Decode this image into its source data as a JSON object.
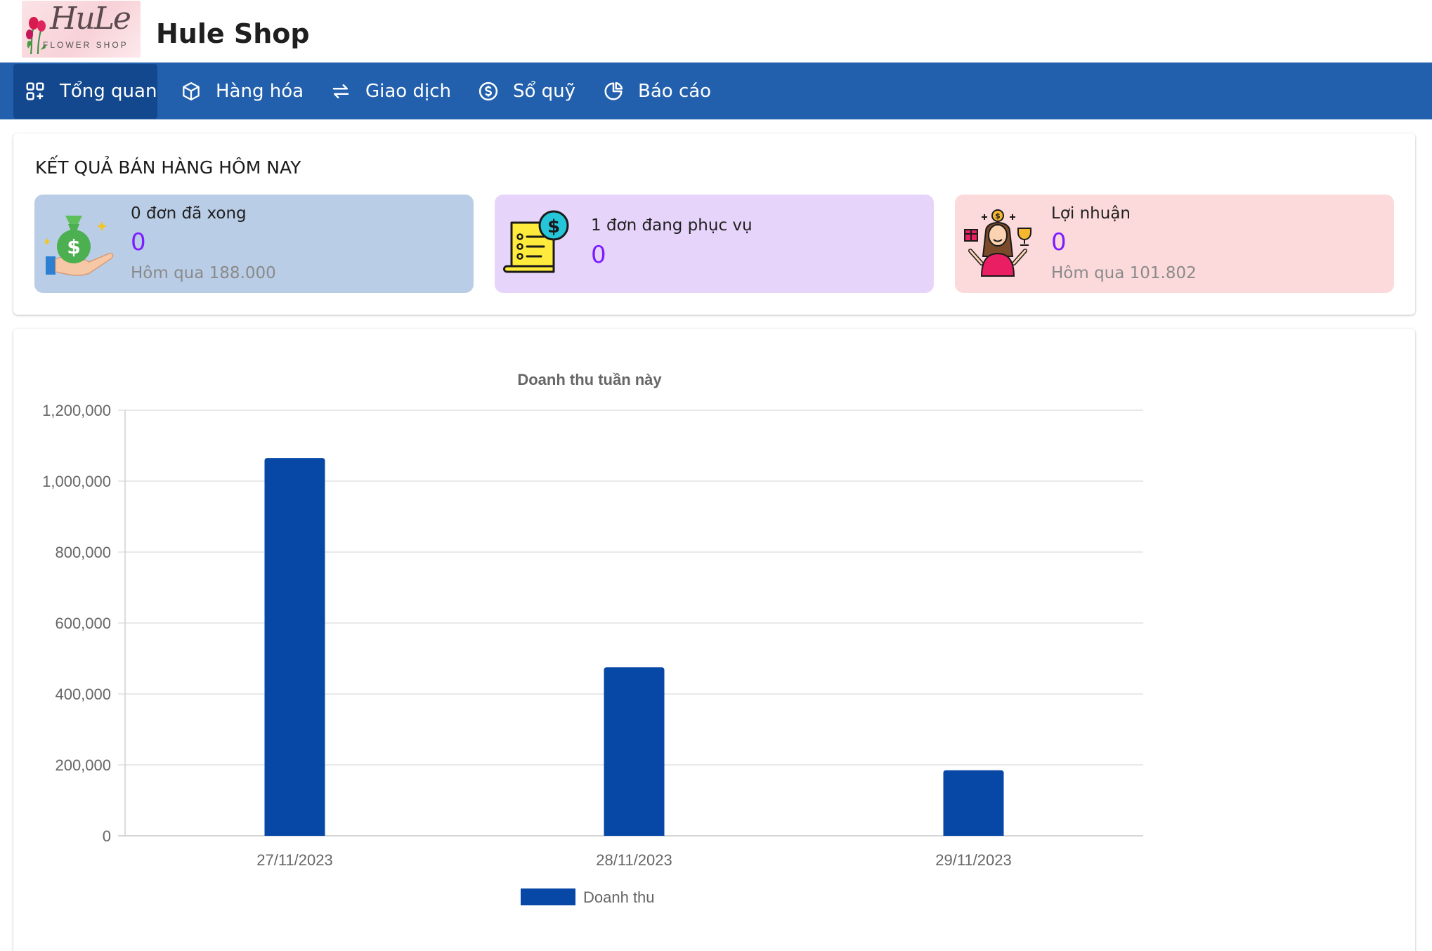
{
  "header": {
    "shop_name": "Hule Shop",
    "logo_script": "HuLe",
    "logo_sub": "FLOWER SHOP"
  },
  "nav": {
    "items": [
      {
        "label": "Tổng quan",
        "icon": "dashboard-grid-icon",
        "active": true
      },
      {
        "label": "Hàng hóa",
        "icon": "box-icon",
        "active": false
      },
      {
        "label": "Giao dịch",
        "icon": "arrows-exchange-icon",
        "active": false
      },
      {
        "label": "Sổ quỹ",
        "icon": "dollar-circle-icon",
        "active": false
      },
      {
        "label": "Báo cáo",
        "icon": "pie-chart-icon",
        "active": false
      }
    ],
    "bar_color": "#2260ad",
    "active_color": "#13488f"
  },
  "sales": {
    "title": "KẾT QUẢ BÁN HÀNG HÔM NAY",
    "tiles": [
      {
        "label": "0 đơn đã xong",
        "value": "0",
        "sub": "Hôm qua 188.000",
        "icon": "money-bag-hand-icon",
        "bg": "#b9cde6"
      },
      {
        "label": "1 đơn đang phục vụ",
        "value": "0",
        "sub": "",
        "icon": "invoice-dollar-icon",
        "bg": "#e7d4fb"
      },
      {
        "label": "Lợi nhuận",
        "value": "0",
        "sub": "Hôm qua 101.802",
        "icon": "happy-woman-rewards-icon",
        "bg": "#fcdadb"
      }
    ],
    "value_color": "#7d1cff"
  },
  "chart_data": {
    "type": "bar",
    "title": "Doanh thu tuần này",
    "categories": [
      "27/11/2023",
      "28/11/2023",
      "29/11/2023"
    ],
    "series": [
      {
        "name": "Doanh thu",
        "values": [
          1065000,
          475000,
          185000
        ],
        "color": "#0747a6"
      }
    ],
    "ylim": [
      0,
      1200000
    ],
    "yticks": [
      0,
      200000,
      400000,
      600000,
      800000,
      1000000,
      1200000
    ],
    "ytick_labels": [
      "0",
      "200,000",
      "400,000",
      "600,000",
      "800,000",
      "1,000,000",
      "1,200,000"
    ],
    "grid": true,
    "legend": "bottom"
  }
}
